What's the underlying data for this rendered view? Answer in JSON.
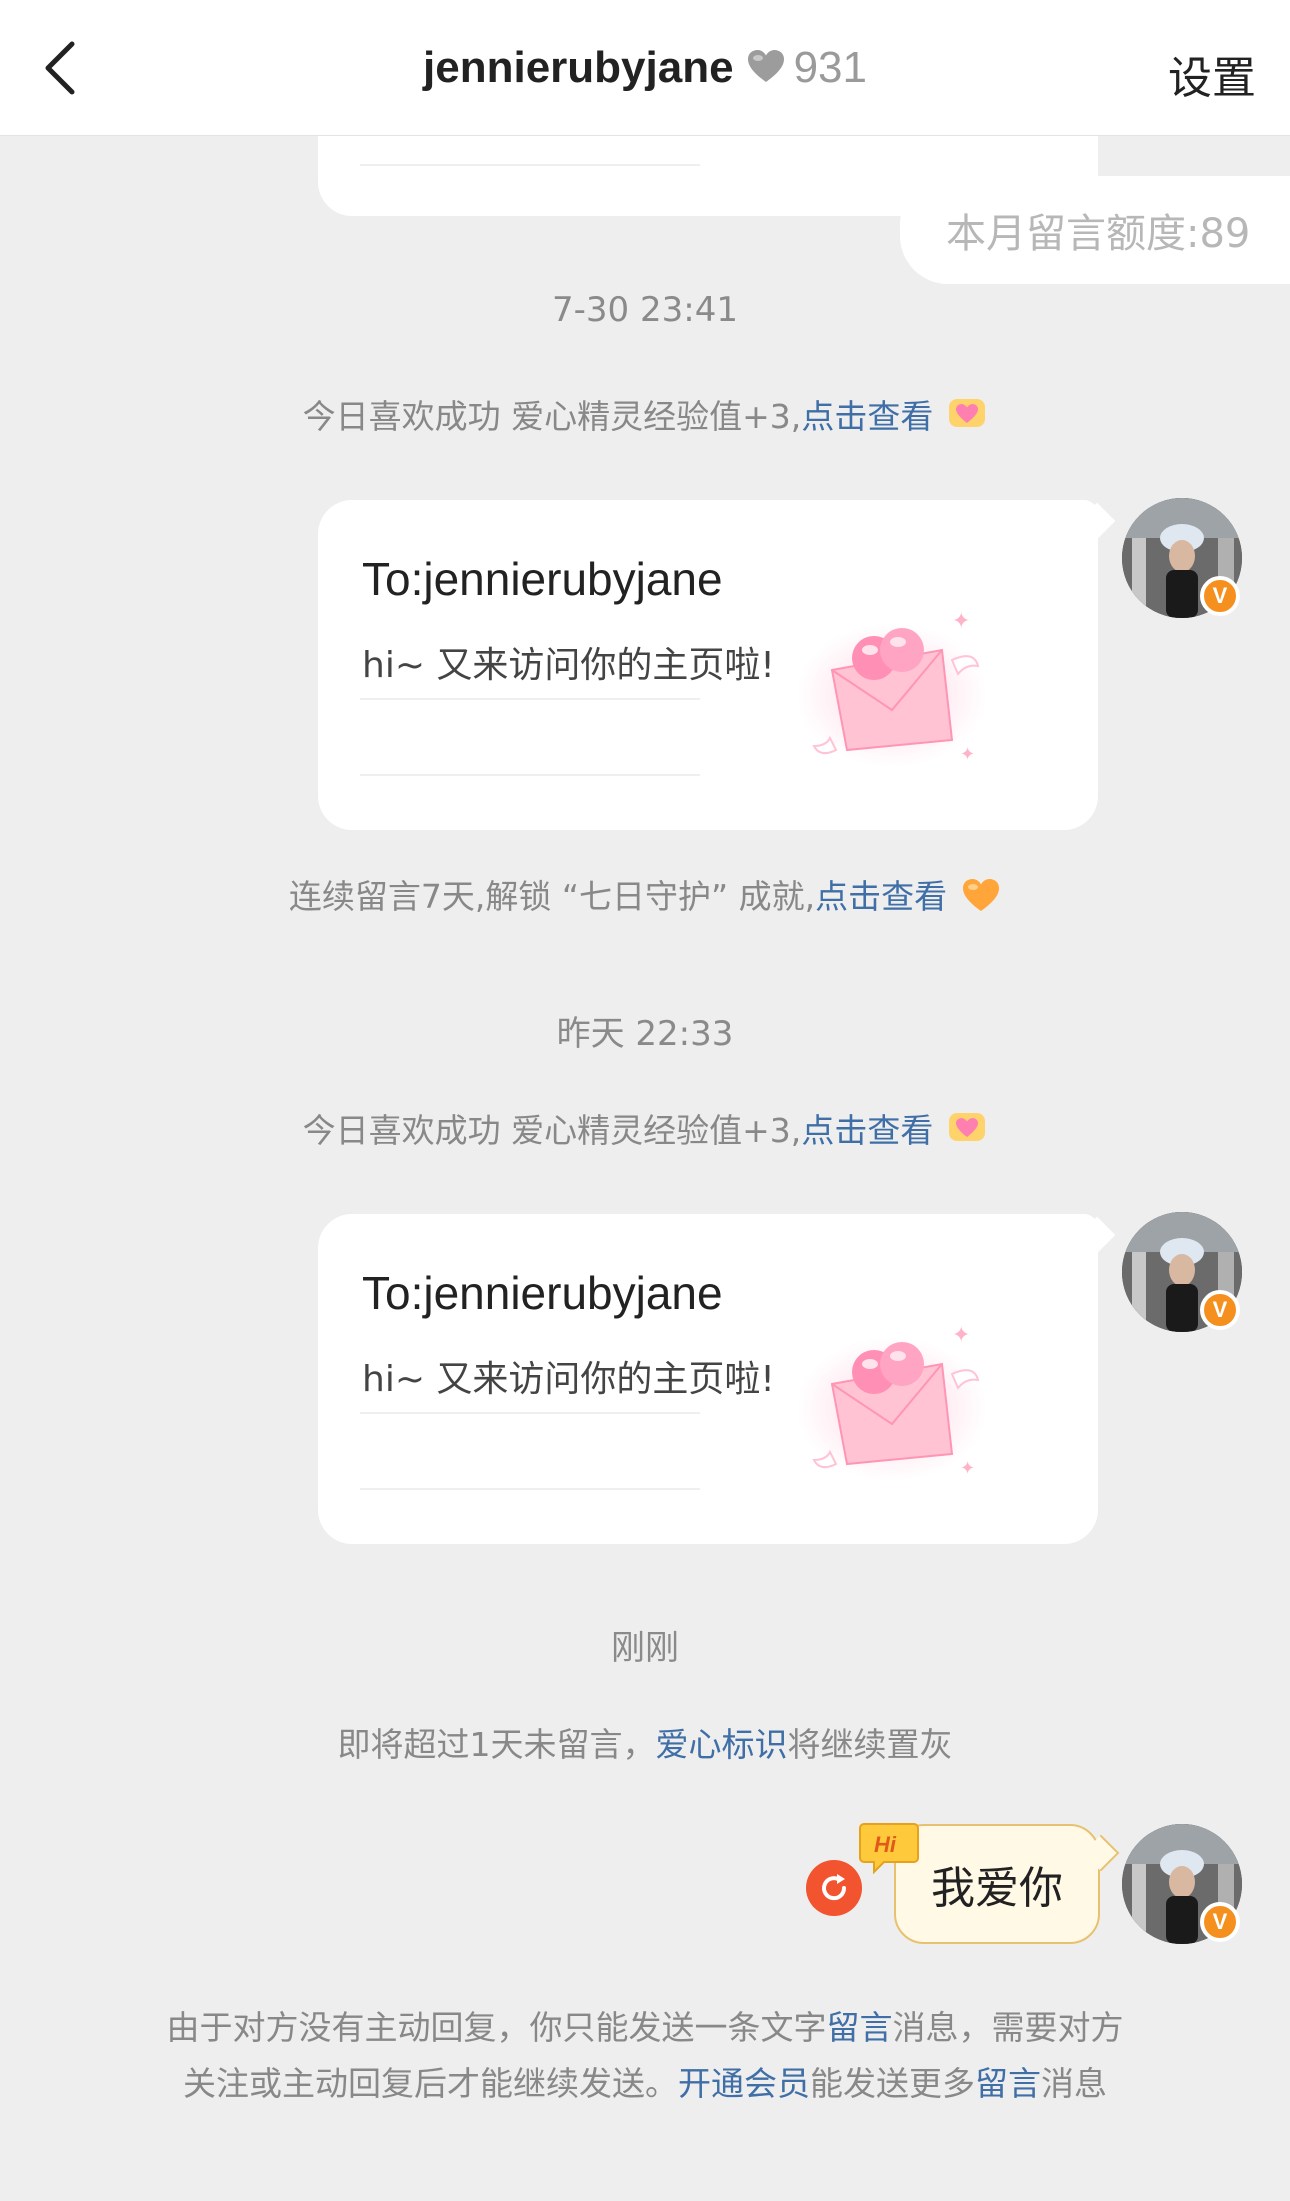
{
  "header": {
    "title": "jennierubyjane",
    "heart_count": "931",
    "settings_label": "设置"
  },
  "quota": {
    "text": "本月留言额度:89"
  },
  "sections": [
    {
      "time": "7-30 23:41",
      "notice": {
        "before": "今日喜欢成功 爱心精灵经验值+3,",
        "link": "点击查看"
      },
      "card": {
        "to": "To:jennierubyjane",
        "message": "hi~ 又来访问你的主页啦!"
      },
      "achievement": {
        "before": "连续留言7天,解锁 “七日守护” 成就,",
        "link": "点击查看"
      }
    },
    {
      "time": "昨天 22:33",
      "notice": {
        "before": "今日喜欢成功 爱心精灵经验值+3,",
        "link": "点击查看"
      },
      "card": {
        "to": "To:jennierubyjane",
        "message": "hi~ 又来访问你的主页啦!"
      }
    }
  ],
  "recent": {
    "time": "刚刚",
    "warning": {
      "before": "即将超过1天未留言，",
      "link": "爱心标识",
      "after": "将继续置灰"
    },
    "chat_message": "我爱你",
    "hi_label": "Hi"
  },
  "avatar": {
    "badge": "V"
  },
  "footer": {
    "line1_before": "由于对方没有主动回复，你只能发送一条文字",
    "line1_link": "留言",
    "line1_after": "消息，需要对方",
    "line2_before": "关注或主动回复后才能继续发送。",
    "line2_link1": "开通会员",
    "line2_mid": "能发送更多",
    "line2_link2": "留言",
    "line2_after": "消息"
  },
  "colors": {
    "accent_link": "#3f6fa6",
    "badge_orange": "#f58f1d",
    "resend_red": "#f1542e",
    "bubble_fill": "#fff9e6"
  }
}
